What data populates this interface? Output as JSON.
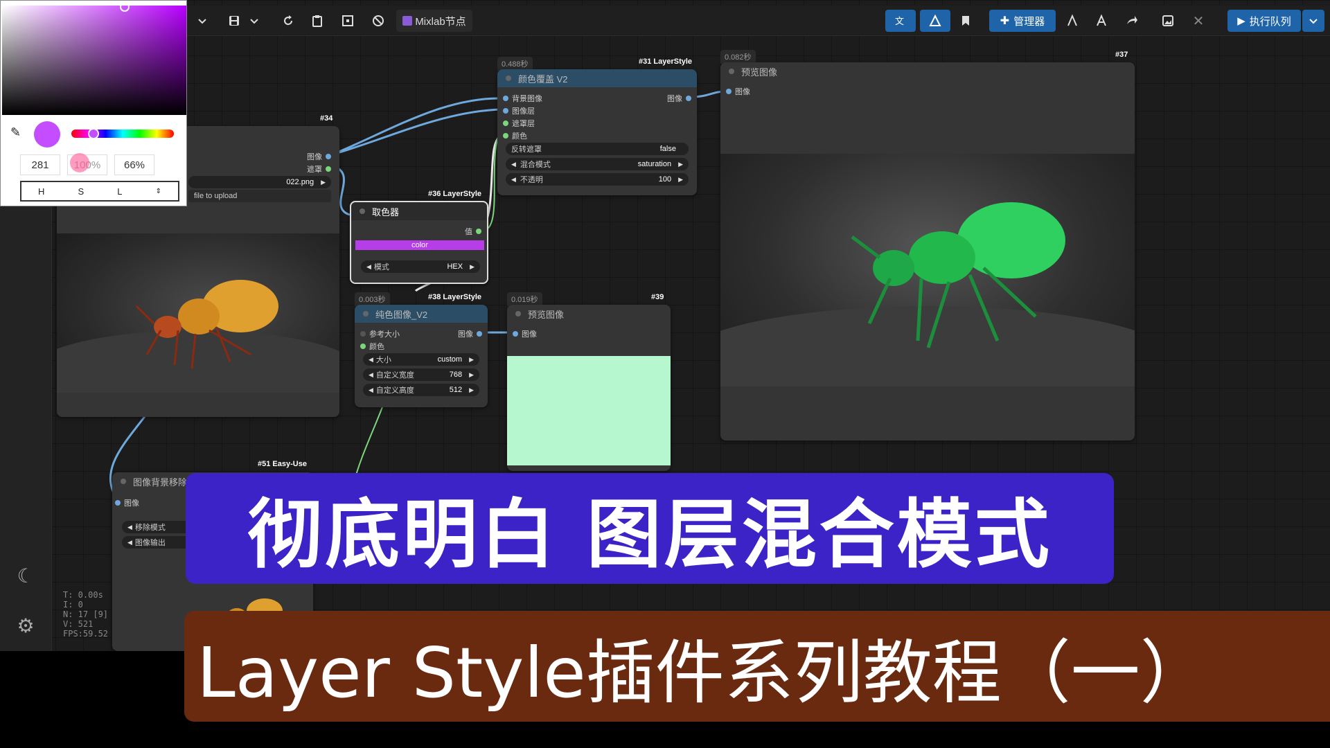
{
  "toolbar": {
    "mixlab_label": "Mixlab节点",
    "manager_label": "管理器",
    "queue_label": "执行队列",
    "icons": [
      "chevron-down-icon",
      "save-icon",
      "refresh-icon",
      "clipboard-icon",
      "fit-icon",
      "block-icon",
      "translate-icon",
      "model-icon",
      "bookmark-icon",
      "puzzle-icon",
      "share-icon",
      "gallery-icon",
      "close-icon",
      "play-icon"
    ]
  },
  "color_picker": {
    "h_value": "281",
    "s_value": "100%",
    "l_value": "66%",
    "mode_h": "H",
    "mode_s": "S",
    "mode_l": "L",
    "swatch_color": "#c44dff"
  },
  "nodes": {
    "n34": {
      "tag": "#34",
      "out1": "图像",
      "out2": "遮罩",
      "file": "022.png",
      "upload": "file to upload"
    },
    "n31": {
      "timing": "0.488秒",
      "tag": "#31 LayerStyle",
      "title": "颜色覆盖 V2",
      "in1": "背景图像",
      "in2": "图像层",
      "in3": "遮罩层",
      "in4": "颜色",
      "out": "图像",
      "w1_label": "反转遮罩",
      "w1_value": "false",
      "w2_label": "混合模式",
      "w2_value": "saturation",
      "w3_label": "不透明",
      "w3_value": "100"
    },
    "n37": {
      "timing": "0.082秒",
      "tag": "#37",
      "title": "预览图像",
      "in": "图像"
    },
    "n36": {
      "tag": "#36 LayerStyle",
      "title": "取色器",
      "out": "值",
      "color_label": "color",
      "color": "#b63de8",
      "mode_label": "模式",
      "mode_value": "HEX"
    },
    "n38": {
      "timing": "0.003秒",
      "tag": "#38 LayerStyle",
      "title": "纯色图像_V2",
      "in1": "参考大小",
      "in2": "颜色",
      "out": "图像",
      "w1_label": "大小",
      "w1_value": "custom",
      "w2_label": "自定义宽度",
      "w2_value": "768",
      "w3_label": "自定义高度",
      "w3_value": "512"
    },
    "n39": {
      "timing": "0.019秒",
      "tag": "#39",
      "title": "预览图像",
      "in": "图像",
      "fill": "#b6f7cf"
    },
    "n51": {
      "tag": "#51 Easy-Use",
      "title": "图像背景移除",
      "in": "图像",
      "w1_label": "移除模式",
      "w2_label": "图像输出"
    }
  },
  "stats": {
    "t": "T: 0.00s",
    "i": "I: 0",
    "n": "N: 17 [9]",
    "v": "V: 521",
    "fps": "FPS:59.52"
  },
  "overlay": {
    "title1": "彻底明白 图层混合模式",
    "title2": "Layer Style插件系列教程（一）"
  }
}
